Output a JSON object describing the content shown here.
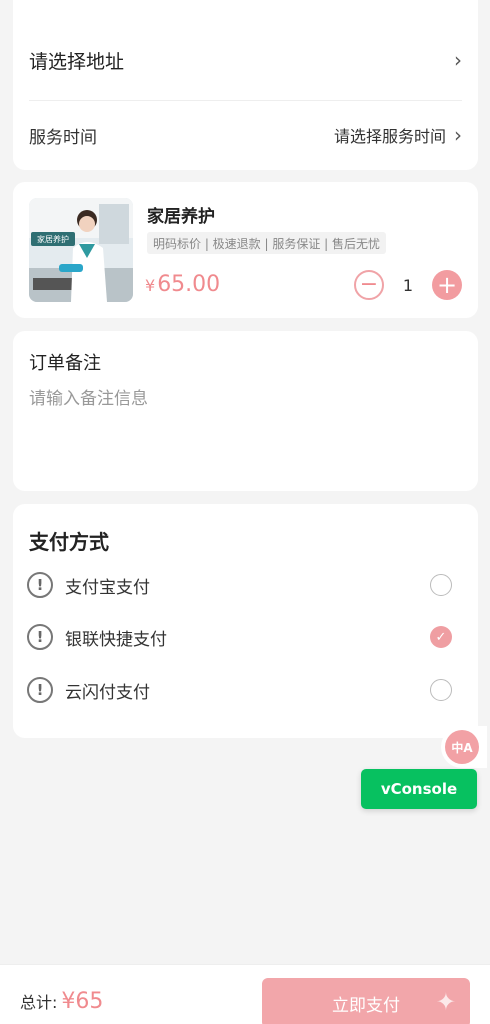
{
  "address": {
    "placeholder_label": "请选择地址"
  },
  "service_time": {
    "label": "服务时间",
    "value": "请选择服务时间"
  },
  "product": {
    "title": "家居养护",
    "tags": "明码标价 | 极速退款 | 服务保证 | 售后无忧",
    "thumb_caption": "家居养护",
    "currency": "¥",
    "price": "65.00",
    "quantity": "1"
  },
  "remark": {
    "title": "订单备注",
    "placeholder": "请输入备注信息",
    "value": ""
  },
  "payment": {
    "title": "支付方式",
    "methods": [
      {
        "label": "支付宝支付",
        "selected": false
      },
      {
        "label": "银联快捷支付",
        "selected": true
      },
      {
        "label": "云闪付支付",
        "selected": false
      }
    ]
  },
  "floating": {
    "translate_glyph": "中A",
    "vconsole_label": "vConsole"
  },
  "footer": {
    "total_label": "总计:",
    "total_amount": "¥65",
    "pay_button": "立即支付"
  },
  "colors": {
    "accent": "#f08a8e",
    "button": "#f2a6aa",
    "vconsole": "#07c160"
  },
  "icons": {
    "chevron": "chevron-right-icon",
    "alert": "alert-circle-icon",
    "check": "check-icon",
    "translate": "translate-icon"
  }
}
